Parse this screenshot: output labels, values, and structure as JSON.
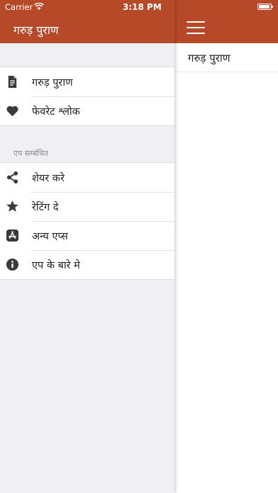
{
  "status_bar": {
    "carrier": "Carrier",
    "time": "3:18 PM"
  },
  "drawer": {
    "title": "गरुड़ पुराण",
    "primary_items": [
      {
        "label": "गरुड़ पुराण",
        "icon": "document-icon"
      },
      {
        "label": "फेवरेट श्लोक",
        "icon": "heart-icon"
      }
    ],
    "section_label": "एप सम्बंधित",
    "app_items": [
      {
        "label": "शेयर करे",
        "icon": "share-icon"
      },
      {
        "label": "रेटिंग दे",
        "icon": "star-icon"
      },
      {
        "label": "अन्य एप्स",
        "icon": "app-store-icon"
      },
      {
        "label": "एप के बारे मे",
        "icon": "info-icon"
      }
    ]
  },
  "main": {
    "list": [
      {
        "label": "गरुड़ पुराण"
      }
    ]
  },
  "colors": {
    "accent": "#b64a28",
    "drawer_bg": "#efeff4",
    "icon": "#3a3a3c"
  }
}
